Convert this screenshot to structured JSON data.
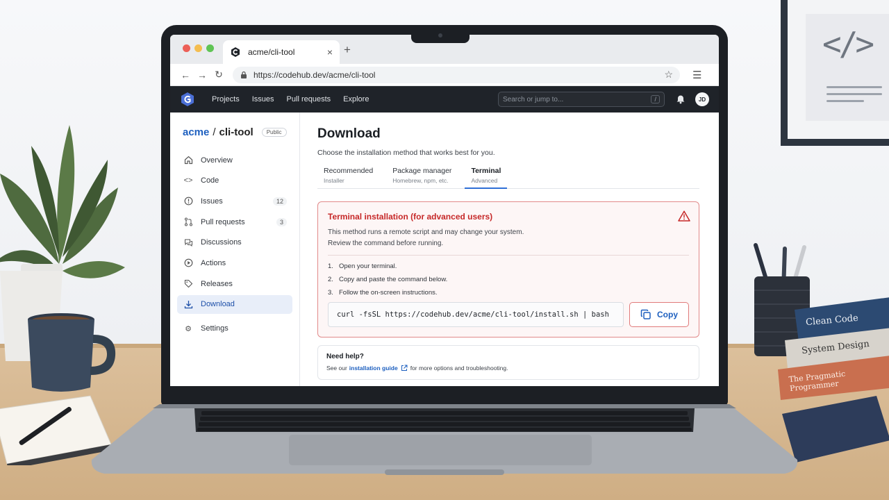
{
  "browser": {
    "tab_title": "acme/cli-tool",
    "new_tab": "+",
    "close": "×",
    "url": "https://codehub.dev/acme/cli-tool"
  },
  "header": {
    "nav": [
      "Projects",
      "Issues",
      "Pull requests",
      "Explore"
    ],
    "search_placeholder": "Search or jump to...",
    "search_key": "/",
    "avatar_initials": "JD"
  },
  "repo": {
    "owner": "acme",
    "separator": "/",
    "name": "cli-tool",
    "visibility": "Public"
  },
  "sidebar": {
    "items": [
      {
        "label": "Overview",
        "icon": "home-icon"
      },
      {
        "label": "Code",
        "icon": "code-icon"
      },
      {
        "label": "Issues",
        "icon": "issue-icon",
        "count": "12"
      },
      {
        "label": "Pull requests",
        "icon": "pull-request-icon",
        "count": "3"
      },
      {
        "label": "Discussions",
        "icon": "discussion-icon"
      },
      {
        "label": "Actions",
        "icon": "play-icon"
      },
      {
        "label": "Releases",
        "icon": "tag-icon"
      },
      {
        "label": "Download",
        "icon": "download-icon",
        "active": true
      }
    ],
    "settings": "Settings"
  },
  "main": {
    "title": "Download",
    "subtitle": "Choose the installation method that works best for you.",
    "tabs": [
      {
        "label": "Recommended",
        "sub": "Installer"
      },
      {
        "label": "Package manager",
        "sub": "Homebrew, npm, etc."
      },
      {
        "label": "Terminal",
        "sub": "Advanced",
        "active": true
      }
    ],
    "warning": {
      "title": "Terminal installation (for advanced users)",
      "line1": "This method runs a remote script and may change your system.",
      "line2": "Review the command before running.",
      "steps": [
        "Open your terminal.",
        "Copy and paste the command below.",
        "Follow the on-screen instructions."
      ],
      "command": "curl -fsSL https://codehub.dev/acme/cli-tool/install.sh | bash",
      "copy_label": "Copy"
    },
    "help": {
      "title": "Need help?",
      "prefix": "See our",
      "link": "installation guide",
      "suffix": "for more options and troubleshooting."
    }
  },
  "scene": {
    "frame_symbol": "</>",
    "books": [
      "Clean Code",
      "System Design",
      "The Pragmatic Programmer"
    ]
  },
  "colors": {
    "accent": "#1d5fbf",
    "danger": "#c62828",
    "header_bg": "#1f2329"
  }
}
